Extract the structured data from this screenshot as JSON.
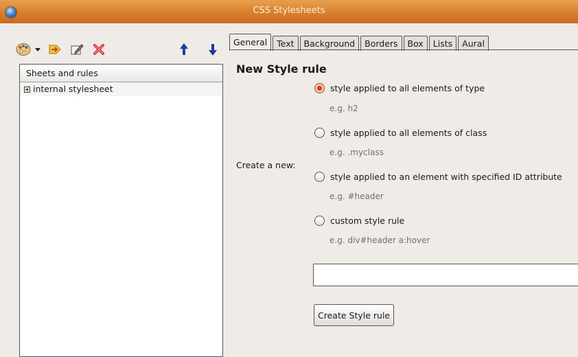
{
  "window": {
    "title": "CSS Stylesheets"
  },
  "toolbar": {
    "icons": [
      "palette-icon",
      "dropdown-arrow-icon",
      "import-sheet-icon",
      "edit-icon",
      "delete-icon",
      "move-up-icon",
      "move-down-icon"
    ]
  },
  "tree": {
    "header": "Sheets and rules",
    "items": [
      {
        "label": "internal stylesheet"
      }
    ]
  },
  "tabs": [
    "General",
    "Text",
    "Background",
    "Borders",
    "Box",
    "Lists",
    "Aural"
  ],
  "active_tab": "General",
  "panel": {
    "title": "New Style rule",
    "create_label": "Create a new:",
    "options": [
      {
        "label": "style applied to all elements of type",
        "example": "e.g. h2",
        "checked": true
      },
      {
        "label": "style applied to all elements of class",
        "example": "e.g. .myclass",
        "checked": false
      },
      {
        "label": "style applied to an element with specified ID attribute",
        "example": "e.g. #header",
        "checked": false
      },
      {
        "label": "custom style rule",
        "example": "e.g. div#header a:hover",
        "checked": false
      }
    ],
    "input_value": "",
    "create_button": "Create Style rule"
  },
  "colors": {
    "titlebar": "#d87f2c",
    "radio_checked": "#d9430c",
    "arrows": "#1a3f9a",
    "delete": "#d03030"
  }
}
